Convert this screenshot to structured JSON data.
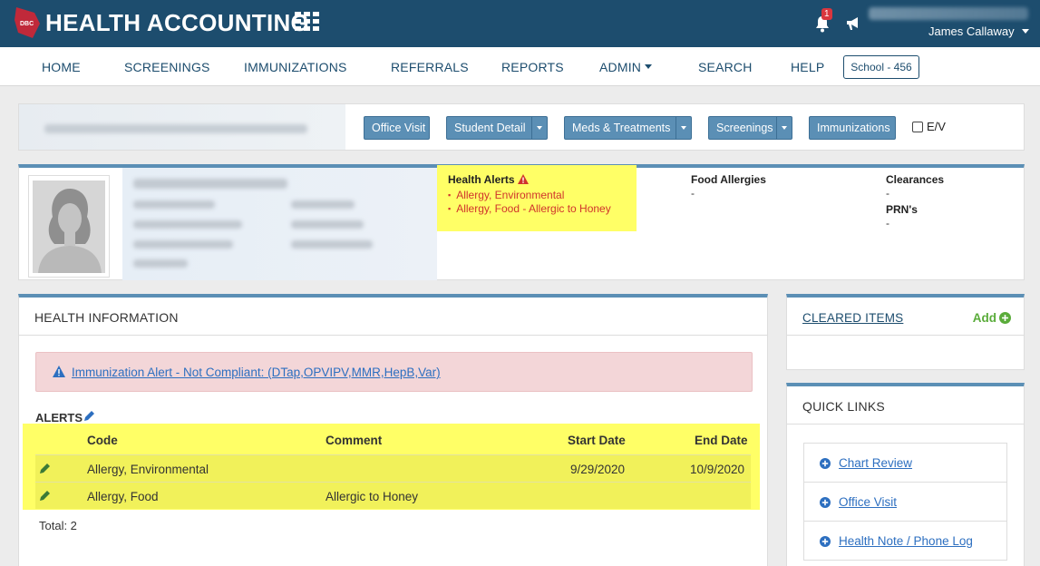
{
  "app": {
    "title": "HEALTH ACCOUNTING",
    "notification_count": "1",
    "user_name": "James Callaway"
  },
  "nav": {
    "items": [
      "HOME",
      "SCREENINGS",
      "IMMUNIZATIONS",
      "REFERRALS",
      "REPORTS",
      "ADMIN",
      "SEARCH",
      "HELP"
    ],
    "school": "School - 456"
  },
  "actions": {
    "office_visit": "Office Visit",
    "student_detail": "Student Detail",
    "meds_treatments": "Meds & Treatments",
    "screenings": "Screenings",
    "immunizations": "Immunizations",
    "ev_label": "E/V"
  },
  "student_card": {
    "health_alerts_title": "Health Alerts",
    "health_alerts": [
      "Allergy, Environmental",
      "Allergy, Food - Allergic to Honey"
    ],
    "food_allergies_title": "Food Allergies",
    "food_allergies_value": "-",
    "clearances_title": "Clearances",
    "clearances_value": "-",
    "prn_title": "PRN's",
    "prn_value": "-"
  },
  "health_info": {
    "title": "HEALTH INFORMATION",
    "immunization_alert": "Immunization Alert - Not Compliant: (DTap,OPVIPV,MMR,HepB,Var)",
    "alerts_label": "ALERTS",
    "columns": [
      "Code",
      "Comment",
      "Start Date",
      "End Date"
    ],
    "rows": [
      {
        "code": "Allergy, Environmental",
        "comment": "",
        "start": "9/29/2020",
        "end": "10/9/2020"
      },
      {
        "code": "Allergy, Food",
        "comment": "Allergic to Honey",
        "start": "",
        "end": ""
      }
    ],
    "total": "Total: 2"
  },
  "cleared_items": {
    "title": "CLEARED ITEMS",
    "add_label": "Add"
  },
  "quick_links": {
    "title": "QUICK LINKS",
    "items": [
      "Chart Review",
      "Office Visit",
      "Health Note / Phone Log"
    ]
  },
  "colors": {
    "header": "#1d4d6e",
    "accent": "#5b8fb5",
    "highlight": "#ffff66",
    "alert_red": "#d0342c",
    "link_blue": "#2d6fc0",
    "add_green": "#5aac3a"
  }
}
